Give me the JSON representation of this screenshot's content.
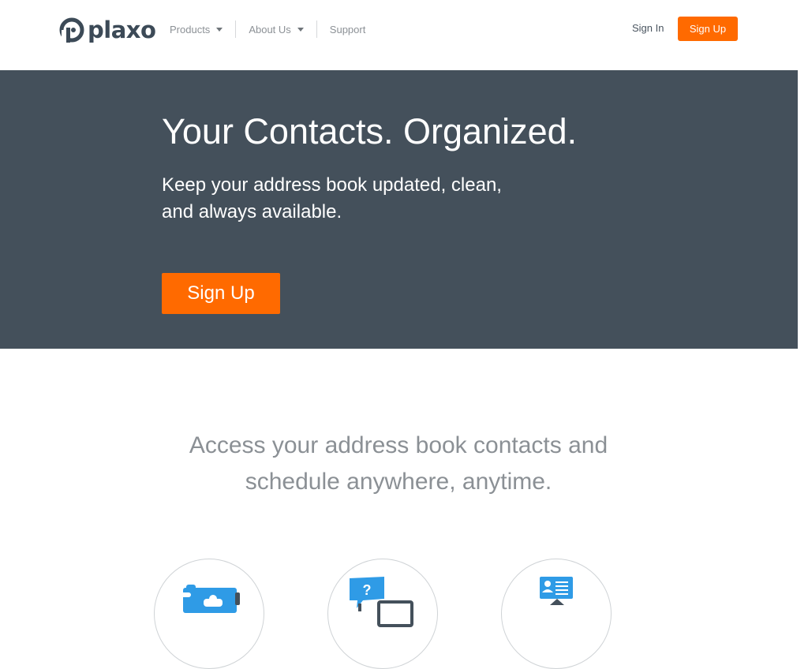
{
  "brand": {
    "name": "plaxo",
    "text_color": "#3c4a57",
    "accent_color": "#ff6a00"
  },
  "nav": {
    "items": [
      {
        "label": "Products",
        "has_dropdown": true
      },
      {
        "label": "About Us",
        "has_dropdown": true
      },
      {
        "label": "Support",
        "has_dropdown": false
      }
    ]
  },
  "auth": {
    "signin_label": "Sign In",
    "signup_label": "Sign Up"
  },
  "hero": {
    "title": "Your Contacts. Organized.",
    "subtitle_line1": "Keep your address book updated, clean,",
    "subtitle_line2": "and always available.",
    "cta_label": "Sign Up",
    "background_color": "#44505b"
  },
  "tagline": {
    "line1": "Access your address book contacts and",
    "line2": "schedule anywhere, anytime."
  },
  "features": [
    {
      "icon": "puzzle-sync-icon"
    },
    {
      "icon": "question-bubble-icon"
    },
    {
      "icon": "contact-card-icon"
    }
  ]
}
